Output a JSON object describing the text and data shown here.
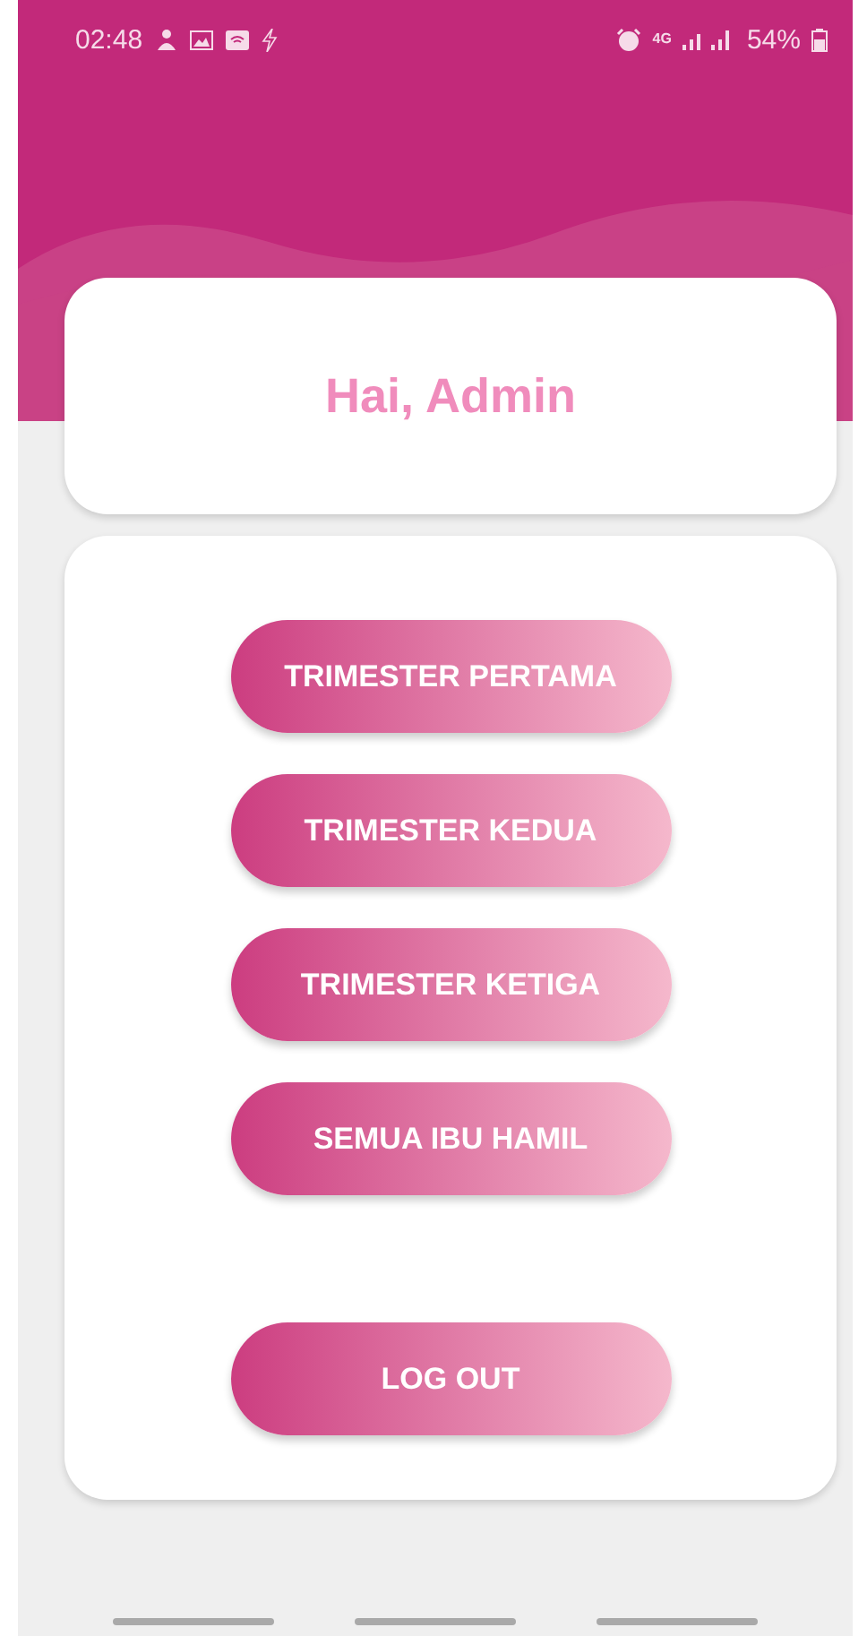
{
  "status_bar": {
    "time": "02:48",
    "network": "4G",
    "battery": "54%"
  },
  "greeting": "Hai, Admin",
  "buttons": [
    {
      "label": "TRIMESTER PERTAMA",
      "kind": "menu"
    },
    {
      "label": "TRIMESTER KEDUA",
      "kind": "menu"
    },
    {
      "label": "TRIMESTER KETIGA",
      "kind": "menu"
    },
    {
      "label": "SEMUA IBU HAMIL",
      "kind": "menu"
    },
    {
      "label": "LOG OUT",
      "kind": "logout"
    }
  ]
}
